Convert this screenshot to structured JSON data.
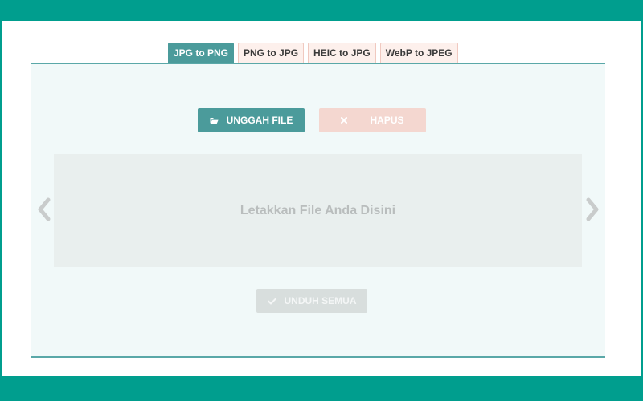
{
  "tabs": [
    {
      "label": "JPG to PNG",
      "active": true
    },
    {
      "label": "PNG to JPG",
      "active": false
    },
    {
      "label": "HEIC to JPG",
      "active": false
    },
    {
      "label": "WebP to JPEG",
      "active": false
    }
  ],
  "toolbar": {
    "upload_label": "UNGGAH FILE",
    "upload_icon": "folder-open-icon",
    "clear_label": "HAPUS",
    "clear_icon": "close-icon"
  },
  "dropzone": {
    "text": "Letakkan File Anda Disini"
  },
  "download_all": {
    "label": "UNDUH SEMUA",
    "icon": "check-icon"
  },
  "colors": {
    "frame": "#009e8e",
    "accent": "#4b9b9b",
    "tab_inactive_bg": "#fdf0ec",
    "panel_bg": "#f1f9f9",
    "clear_bg": "#f4d7d0",
    "disabled_bg": "#d8dedd"
  }
}
